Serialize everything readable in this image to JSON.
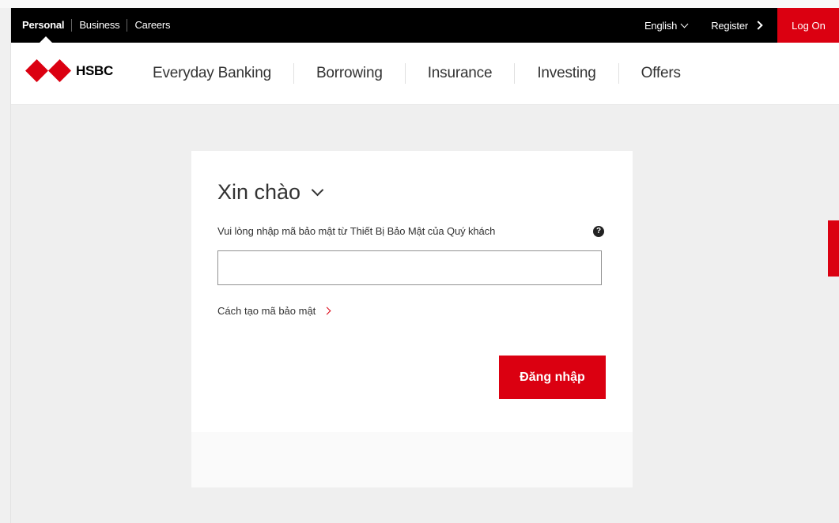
{
  "topbar": {
    "segments": [
      "Personal",
      "Business",
      "Careers"
    ],
    "language": "English",
    "register": "Register",
    "logon": "Log On"
  },
  "brand": {
    "name": "HSBC"
  },
  "nav": {
    "items": [
      "Everyday Banking",
      "Borrowing",
      "Insurance",
      "Investing",
      "Offers"
    ]
  },
  "login": {
    "greeting": "Xin chào",
    "field_label": "Vui lòng nhập mã bảo mật từ Thiết Bị Bảo Mật của Quý khách",
    "help_icon_glyph": "?",
    "code_value": "",
    "help_link": "Cách tạo mã bảo mật",
    "submit": "Đăng nhập"
  },
  "colors": {
    "brand_red": "#db0011",
    "topbar_bg": "#000000",
    "page_bg": "#efefef"
  },
  "icons": {
    "logo": "hsbc-hexagon-logo",
    "help": "question-circle-icon",
    "greeting_toggle": "chevron-down-icon",
    "link_arrow": "chevron-right-icon"
  }
}
